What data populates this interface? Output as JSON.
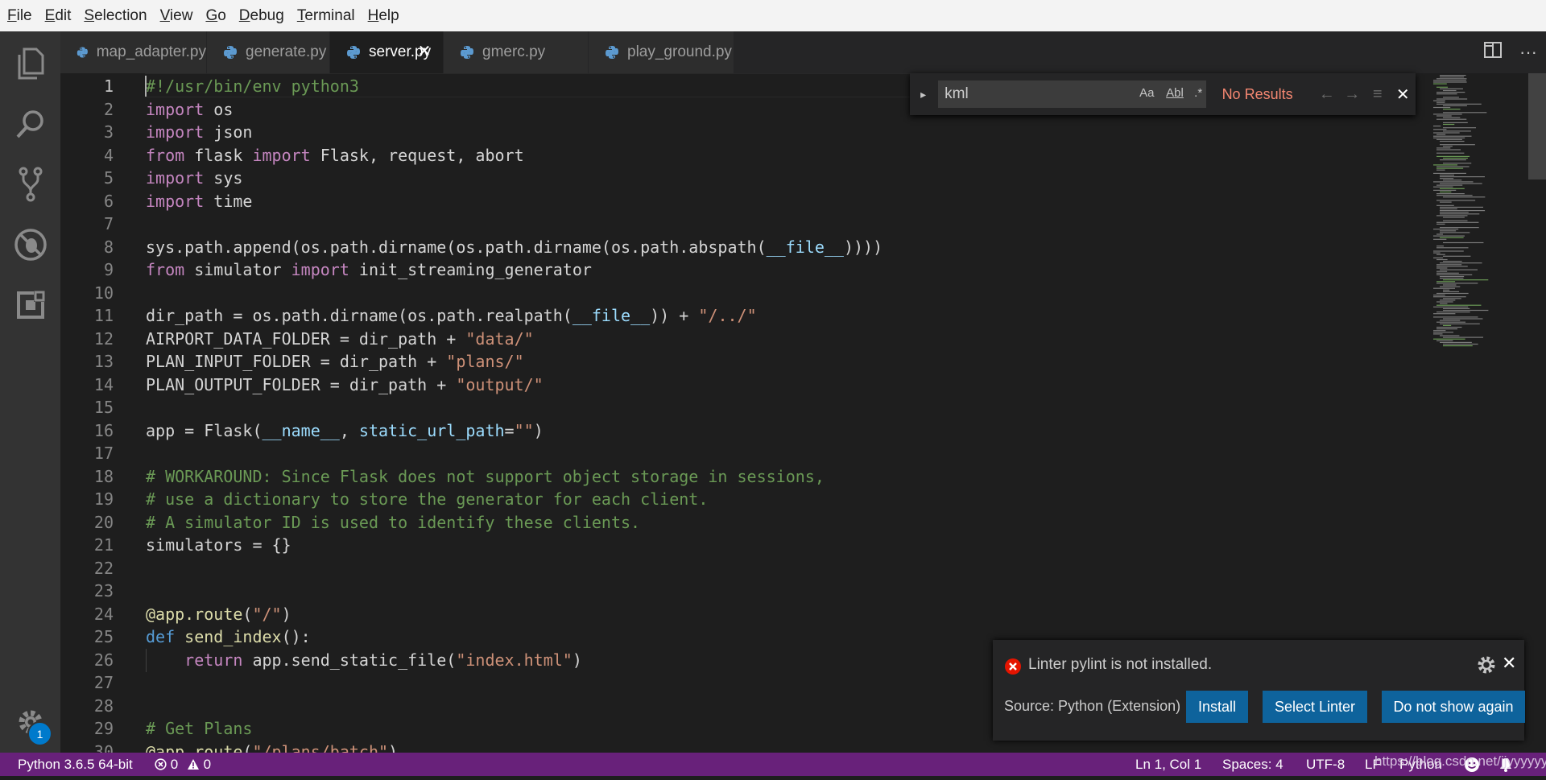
{
  "menu": [
    {
      "mnemonic": "F",
      "rest": "ile"
    },
    {
      "mnemonic": "E",
      "rest": "dit"
    },
    {
      "mnemonic": "S",
      "rest": "election"
    },
    {
      "mnemonic": "V",
      "rest": "iew"
    },
    {
      "mnemonic": "G",
      "rest": "o"
    },
    {
      "mnemonic": "D",
      "rest": "ebug"
    },
    {
      "mnemonic": "T",
      "rest": "erminal"
    },
    {
      "mnemonic": "H",
      "rest": "elp"
    }
  ],
  "activity": {
    "icons": [
      "explorer-icon",
      "search-icon",
      "source-control-icon",
      "debug-icon",
      "extensions-icon",
      "settings-gear-icon"
    ],
    "badge": "1"
  },
  "tabs": [
    {
      "label": "map_adapter.py",
      "active": false
    },
    {
      "label": "generate.py",
      "active": false
    },
    {
      "label": "server.py",
      "active": true
    },
    {
      "label": "gmerc.py",
      "active": false
    },
    {
      "label": "play_ground.py",
      "active": false
    }
  ],
  "tab_close": "✕",
  "editor_actions": {
    "split": "split-editor-icon",
    "more": "···"
  },
  "code_lines": [
    {
      "n": "1",
      "tokens": [
        [
          "cmt",
          "#!/usr/bin/env python3"
        ]
      ]
    },
    {
      "n": "2",
      "tokens": [
        [
          "kw",
          "import"
        ],
        [
          "t",
          " os"
        ]
      ]
    },
    {
      "n": "3",
      "tokens": [
        [
          "kw",
          "import"
        ],
        [
          "t",
          " json"
        ]
      ]
    },
    {
      "n": "4",
      "tokens": [
        [
          "kw",
          "from"
        ],
        [
          "t",
          " flask "
        ],
        [
          "kw",
          "import"
        ],
        [
          "t",
          " Flask, request, abort"
        ]
      ]
    },
    {
      "n": "5",
      "tokens": [
        [
          "kw",
          "import"
        ],
        [
          "t",
          " sys"
        ]
      ]
    },
    {
      "n": "6",
      "tokens": [
        [
          "kw",
          "import"
        ],
        [
          "t",
          " time"
        ]
      ]
    },
    {
      "n": "7",
      "tokens": []
    },
    {
      "n": "8",
      "tokens": [
        [
          "t",
          "sys.path.append(os.path.dirname(os.path.dirname(os.path.abspath("
        ],
        [
          "var",
          "__file__"
        ],
        [
          "t",
          "))))"
        ]
      ]
    },
    {
      "n": "9",
      "tokens": [
        [
          "kw",
          "from"
        ],
        [
          "t",
          " simulator "
        ],
        [
          "kw",
          "import"
        ],
        [
          "t",
          " init_streaming_generator"
        ]
      ]
    },
    {
      "n": "10",
      "tokens": []
    },
    {
      "n": "11",
      "tokens": [
        [
          "t",
          "dir_path = os.path.dirname(os.path.realpath("
        ],
        [
          "var",
          "__file__"
        ],
        [
          "t",
          ")) + "
        ],
        [
          "str",
          "\"/../\""
        ]
      ]
    },
    {
      "n": "12",
      "tokens": [
        [
          "t",
          "AIRPORT_DATA_FOLDER = dir_path + "
        ],
        [
          "str",
          "\"data/\""
        ]
      ]
    },
    {
      "n": "13",
      "tokens": [
        [
          "t",
          "PLAN_INPUT_FOLDER = dir_path + "
        ],
        [
          "str",
          "\"plans/\""
        ]
      ]
    },
    {
      "n": "14",
      "tokens": [
        [
          "t",
          "PLAN_OUTPUT_FOLDER = dir_path + "
        ],
        [
          "str",
          "\"output/\""
        ]
      ]
    },
    {
      "n": "15",
      "tokens": []
    },
    {
      "n": "16",
      "tokens": [
        [
          "t",
          "app = Flask("
        ],
        [
          "var",
          "__name__"
        ],
        [
          "t",
          ", "
        ],
        [
          "var",
          "static_url_path"
        ],
        [
          "t",
          "="
        ],
        [
          "str",
          "\"\""
        ],
        [
          "t",
          ")"
        ]
      ]
    },
    {
      "n": "17",
      "tokens": []
    },
    {
      "n": "18",
      "tokens": [
        [
          "cmt",
          "# WORKAROUND: Since Flask does not support object storage in sessions,"
        ]
      ]
    },
    {
      "n": "19",
      "tokens": [
        [
          "cmt",
          "# use a dictionary to store the generator for each client."
        ]
      ]
    },
    {
      "n": "20",
      "tokens": [
        [
          "cmt",
          "# A simulator ID is used to identify these clients."
        ]
      ]
    },
    {
      "n": "21",
      "tokens": [
        [
          "t",
          "simulators = {}"
        ]
      ]
    },
    {
      "n": "22",
      "tokens": []
    },
    {
      "n": "23",
      "tokens": []
    },
    {
      "n": "24",
      "tokens": [
        [
          "fn",
          "@app.route"
        ],
        [
          "t",
          "("
        ],
        [
          "str",
          "\"/\""
        ],
        [
          "t",
          ")"
        ]
      ]
    },
    {
      "n": "25",
      "tokens": [
        [
          "kwb",
          "def"
        ],
        [
          "t",
          " "
        ],
        [
          "fn",
          "send_index"
        ],
        [
          "t",
          "():"
        ]
      ]
    },
    {
      "n": "26",
      "tokens": [
        [
          "t",
          "    "
        ],
        [
          "kw",
          "return"
        ],
        [
          "t",
          " app.send_static_file("
        ],
        [
          "str",
          "\"index.html\""
        ],
        [
          "t",
          ")"
        ]
      ]
    },
    {
      "n": "27",
      "tokens": []
    },
    {
      "n": "28",
      "tokens": []
    },
    {
      "n": "29",
      "tokens": [
        [
          "cmt",
          "# Get Plans"
        ]
      ]
    },
    {
      "n": "30",
      "tokens": [
        [
          "fn",
          "@app.route"
        ],
        [
          "t",
          "("
        ],
        [
          "str",
          "\"/plans/batch\""
        ],
        [
          "t",
          ")"
        ]
      ]
    }
  ],
  "find": {
    "toggle": "▸",
    "value": "kml",
    "opt_case": "Aa",
    "opt_word": "Abl",
    "opt_regex": ".*",
    "result": "No Results",
    "prev": "←",
    "next": "→",
    "selection": "≡",
    "close": "✕"
  },
  "notification": {
    "message": "Linter pylint is not installed.",
    "source": "Source: Python (Extension)",
    "buttons": [
      "Install",
      "Select Linter",
      "Do not show again"
    ],
    "close": "✕"
  },
  "status": {
    "interpreter": "Python 3.6.5 64-bit",
    "errors": "0",
    "warnings": "0",
    "cursor": "Ln 1, Col 1",
    "spaces": "Spaces: 4",
    "encoding": "UTF-8",
    "eol": "LF",
    "language": "Python"
  },
  "watermark": "https://blog.csdn.net/jjyyyyyy"
}
